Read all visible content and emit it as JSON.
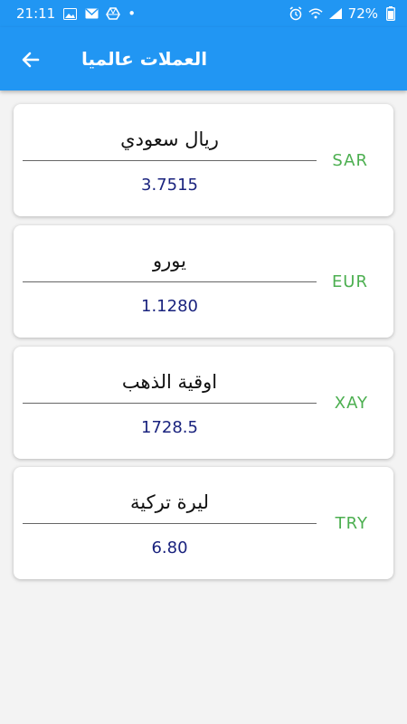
{
  "status_bar": {
    "time": "21:11",
    "dot": "•",
    "battery": "72%"
  },
  "app_bar": {
    "title": "العملات عالميا"
  },
  "currencies": [
    {
      "name": "ريال سعودي",
      "rate": "3.7515",
      "code": "SAR"
    },
    {
      "name": "يورو",
      "rate": "1.1280",
      "code": "EUR"
    },
    {
      "name": "اوقية الذهب",
      "rate": "1728.5",
      "code": "XAY"
    },
    {
      "name": "ليرة تركية",
      "rate": "6.80",
      "code": "TRY"
    }
  ],
  "colors": {
    "primary": "#2196f3",
    "code": "#4caf50",
    "rate": "#1a237e"
  },
  "icons": {
    "back": "arrow-left-icon"
  }
}
